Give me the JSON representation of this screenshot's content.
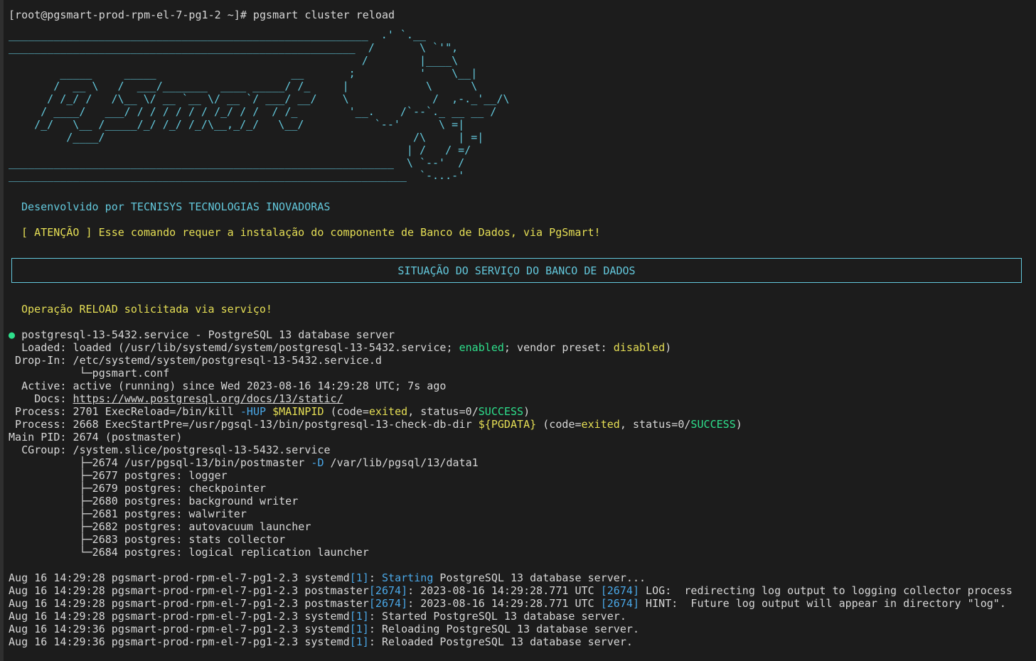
{
  "prompt": {
    "text": "[root@pgsmart-prod-rpm-el-7-pg1-2 ~]# pgsmart cluster reload"
  },
  "banner": {
    "ascii": "________________________________________________________  .' `.__\n______________________________________________________  /       \\ `'\",\n                                                       /        |____\\\n        _____     _____                     __       ;          '    \\__|\n       /  __ \\   /  ___/_______  ____ _____/ /_     |            \\      \\\n      / /_/ /   /\\__ \\/ __ `__ \\/ __ `/ ___/ __/    \\             /  ,-._'__/\\\n     / ____/   ___/ / / / / / / /_/ / /  / /_        '__.    /`--`._ __ __ /\n    /_/   \\__ /_____/_/ /_/ /_/\\__,_/_/   \\__/           `--'      \\ =|\n         /____/                                                /\\     | =|\n                                                              | /   / =/\n____________________________________________________________  \\ `--'  /\n______________________________________________________________  `-...-'",
    "developer": "Desenvolvido por TECNISYS TECNOLOGIAS INOVADORAS",
    "warning": "[ ATENÇÃO ] Esse comando requer a instalação do componente de Banco de Dados, via PgSmart!"
  },
  "section": {
    "title": "SITUAÇÃO DO SERVIÇO DO BANCO DE DADOS"
  },
  "operation": {
    "text": "Operação RELOAD solicitada via serviço!"
  },
  "status": {
    "bullet": "●",
    "service_line": "postgresql-13-5432.service - PostgreSQL 13 database server",
    "loaded_label": "  Loaded: ",
    "loaded_pre": "loaded (/usr/lib/systemd/system/postgresql-13-5432.service; ",
    "loaded_enabled": "enabled",
    "loaded_mid": "; vendor preset: ",
    "loaded_disabled": "disabled",
    "loaded_post": ")",
    "dropin_label": " Drop-In: ",
    "dropin_value": "/etc/systemd/system/postgresql-13-5432.service.d",
    "dropin_file": "           └─pgsmart.conf",
    "active_label": "  Active: ",
    "active_value": "active (running) since Wed 2023-08-16 14:29:28 UTC; 7s ago",
    "docs_label": "    Docs: ",
    "docs_url": "https://www.postgresql.org/docs/13/static/",
    "process1_label": " Process: ",
    "process1_pre": "2701 ExecReload=/bin/kill ",
    "process1_flag": "-HUP",
    "process1_sp": " ",
    "process1_var": "$MAINPID",
    "process1_mid": " (code=",
    "process1_code": "exited",
    "process1_status": ", status=0/",
    "process1_success": "SUCCESS",
    "process1_post": ")",
    "process2_label": " Process: ",
    "process2_pre": "2668 ExecStartPre=/usr/pgsql-13/bin/postgresql-13-check-db-dir ",
    "process2_var": "${PGDATA}",
    "process2_mid": " (code=",
    "process2_code": "exited",
    "process2_status": ", status=0/",
    "process2_success": "SUCCESS",
    "process2_post": ")",
    "mainpid_label": "Main PID: ",
    "mainpid_value": "2674 (postmaster)",
    "cgroup_label": "  CGroup: ",
    "cgroup_value": "/system.slice/postgresql-13-5432.service",
    "tree0_pre": "           ├─2674 /usr/pgsql-13/bin/postmaster ",
    "tree0_flag": "-D",
    "tree0_post": " /var/lib/pgsql/13/data1",
    "tree": [
      "           ├─2677 postgres: logger",
      "           ├─2679 postgres: checkpointer",
      "           ├─2680 postgres: background writer",
      "           ├─2681 postgres: walwriter",
      "           ├─2682 postgres: autovacuum launcher",
      "           ├─2683 postgres: stats collector",
      "           └─2684 postgres: logical replication launcher"
    ]
  },
  "journal": {
    "l1_pre": "Aug 16 14:29:28 pgsmart-prod-rpm-el-7-pg1-2.3 systemd",
    "l1_pid": "[1]",
    "l1_sep": ": ",
    "l1_kw": "Starting",
    "l1_post": " PostgreSQL 13 database server...",
    "l2_pre": "Aug 16 14:29:28 pgsmart-prod-rpm-el-7-pg1-2.3 postmaster",
    "l2_pid": "[2674]",
    "l2_mid": ": 2023-08-16 14:29:28.771 UTC ",
    "l2_pid2": "[2674]",
    "l2_post": " LOG:  redirecting log output to logging collector process",
    "l3_pre": "Aug 16 14:29:28 pgsmart-prod-rpm-el-7-pg1-2.3 postmaster",
    "l3_pid": "[2674]",
    "l3_mid": ": 2023-08-16 14:29:28.771 UTC ",
    "l3_pid2": "[2674]",
    "l3_post": " HINT:  Future log output will appear in directory \"log\".",
    "l4_pre": "Aug 16 14:29:28 pgsmart-prod-rpm-el-7-pg1-2.3 systemd",
    "l4_pid": "[1]",
    "l4_post": ": Started PostgreSQL 13 database server.",
    "l5_pre": "Aug 16 14:29:36 pgsmart-prod-rpm-el-7-pg1-2.3 systemd",
    "l5_pid": "[1]",
    "l5_post": ": Reloading PostgreSQL 13 database server.",
    "l6_pre": "Aug 16 14:29:36 pgsmart-prod-rpm-el-7-pg1-2.3 systemd",
    "l6_pid": "[1]",
    "l6_post": ": Reloaded PostgreSQL 13 database server."
  },
  "colors": {
    "background": "#1c1c1c",
    "text": "#d7d7d7",
    "cyan": "#63c8dc",
    "yellow": "#e6df55",
    "green": "#2ee08c",
    "blue": "#4aa8e8"
  }
}
